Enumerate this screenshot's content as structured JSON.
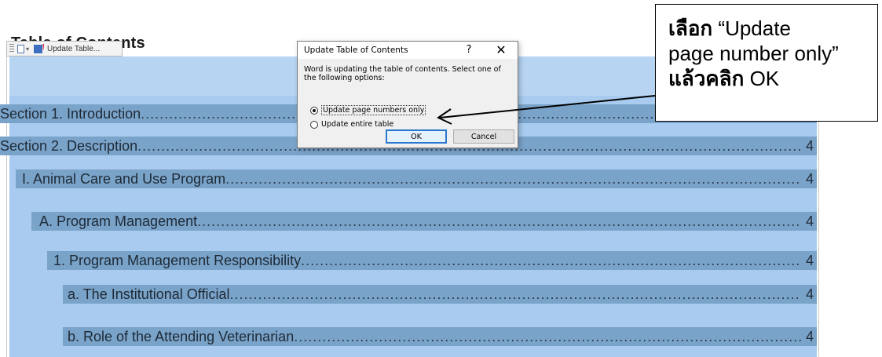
{
  "toc_heading": "Table of Contents",
  "field_toolbar": {
    "label": "Update Table..."
  },
  "toc_rows": [
    {
      "title": "Section 1.  Introduction",
      "page": ""
    },
    {
      "title": "Section 2.  Description",
      "page": "4"
    },
    {
      "title": "I.   Animal Care and Use Program",
      "page": "4"
    },
    {
      "title": "A.  Program Management",
      "page": "4"
    },
    {
      "title": "1.  Program Management Responsibility",
      "page": "4"
    },
    {
      "title": "a.  The Institutional Official",
      "page": "4"
    },
    {
      "title": "b.  Role of the Attending Veterinarian",
      "page": "4"
    }
  ],
  "dialog": {
    "title": "Update Table of Contents",
    "help": "?",
    "close": "✕",
    "message": "Word is updating the table of contents.  Select one of the following options:",
    "option1": "Update page numbers only",
    "option2": "Update entire table",
    "ok": "OK",
    "cancel": "Cancel"
  },
  "callout": {
    "line1_bold": "เลือก",
    "line1_rest": " “Update",
    "line2": "page number only”",
    "line3_bold": "แล้วคลิก",
    "line3_rest": " OK"
  },
  "colors": {
    "selection_light": "#a8cbef",
    "selection_dark": "#7aa3c9",
    "ok_border": "#2a78d0"
  }
}
